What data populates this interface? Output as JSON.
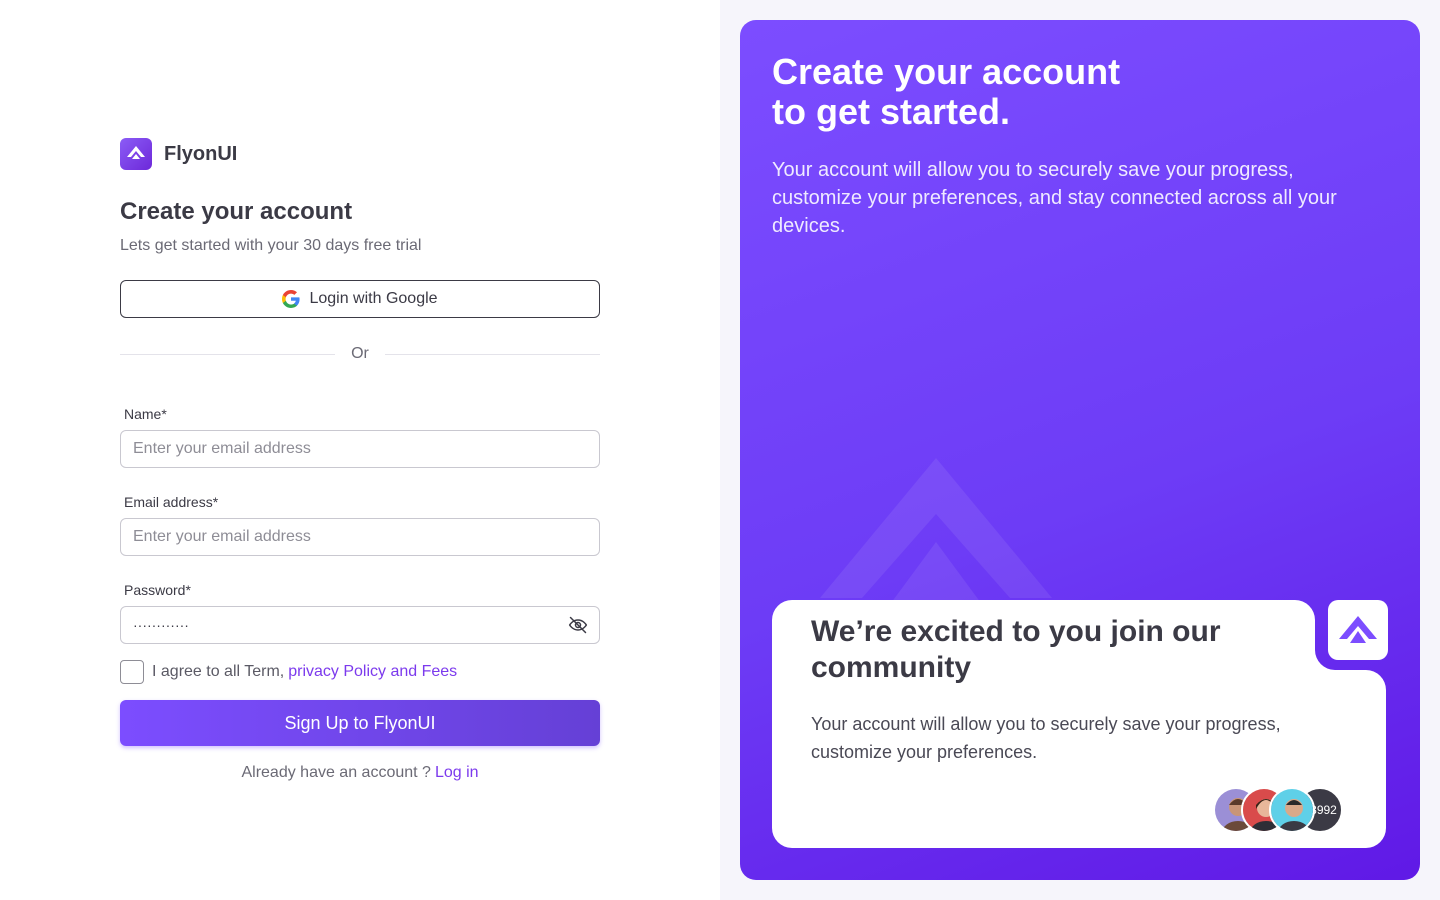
{
  "brand": {
    "name": "FlyonUI",
    "logo_icon": "flyonui-logo-icon",
    "accent_color": "#7c4dff"
  },
  "form": {
    "title": "Create your account",
    "subtitle": "Lets get started with your 30 days free trial",
    "google_button": "Login with Google",
    "divider_text": "Or",
    "name": {
      "label": "Name*",
      "placeholder": "Enter your email address",
      "value": ""
    },
    "email": {
      "label": "Email address*",
      "placeholder": "Enter your email address",
      "value": ""
    },
    "password": {
      "label": "Password*",
      "value": "············",
      "toggle_icon": "eye-off-icon"
    },
    "agree": {
      "text": "I agree to all Term,",
      "link": "privacy Policy and Fees",
      "checked": false
    },
    "submit_button": "Sign Up to FlyonUI",
    "login_prompt": "Already have an account ?",
    "login_link": "Log in"
  },
  "panel": {
    "title_line1": "Create your account",
    "title_line2": "to get started.",
    "description": "Your account will allow you to securely save your progress, customize your preferences, and stay connected across all your devices.",
    "card": {
      "title": "We’re excited to you join our community",
      "description": "Your account will allow you to securely save your progress, customize your preferences.",
      "more_count": "+3992"
    }
  }
}
